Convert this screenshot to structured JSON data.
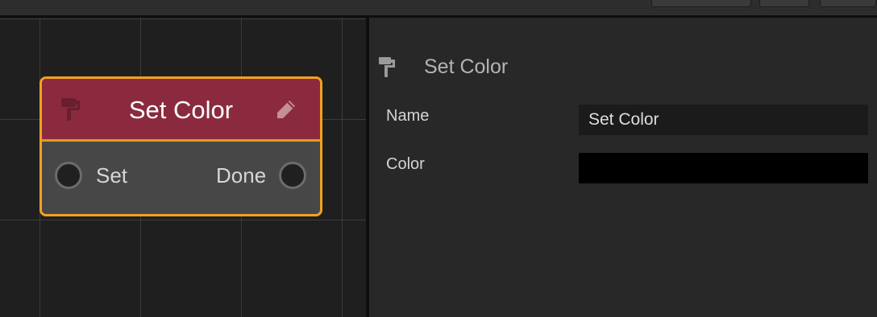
{
  "node": {
    "title": "Set Color",
    "header_color": "#8b2a3e",
    "selection_color": "#f2a11d",
    "icon": "paint-roller-icon",
    "edit_icon": "pencil-icon",
    "input_port": {
      "label": "Set"
    },
    "output_port": {
      "label": "Done"
    }
  },
  "inspector": {
    "icon": "paint-roller-icon",
    "title": "Set Color",
    "properties": [
      {
        "label": "Name",
        "value": "Set Color"
      },
      {
        "label": "Color",
        "value_color": "#000000"
      }
    ]
  }
}
